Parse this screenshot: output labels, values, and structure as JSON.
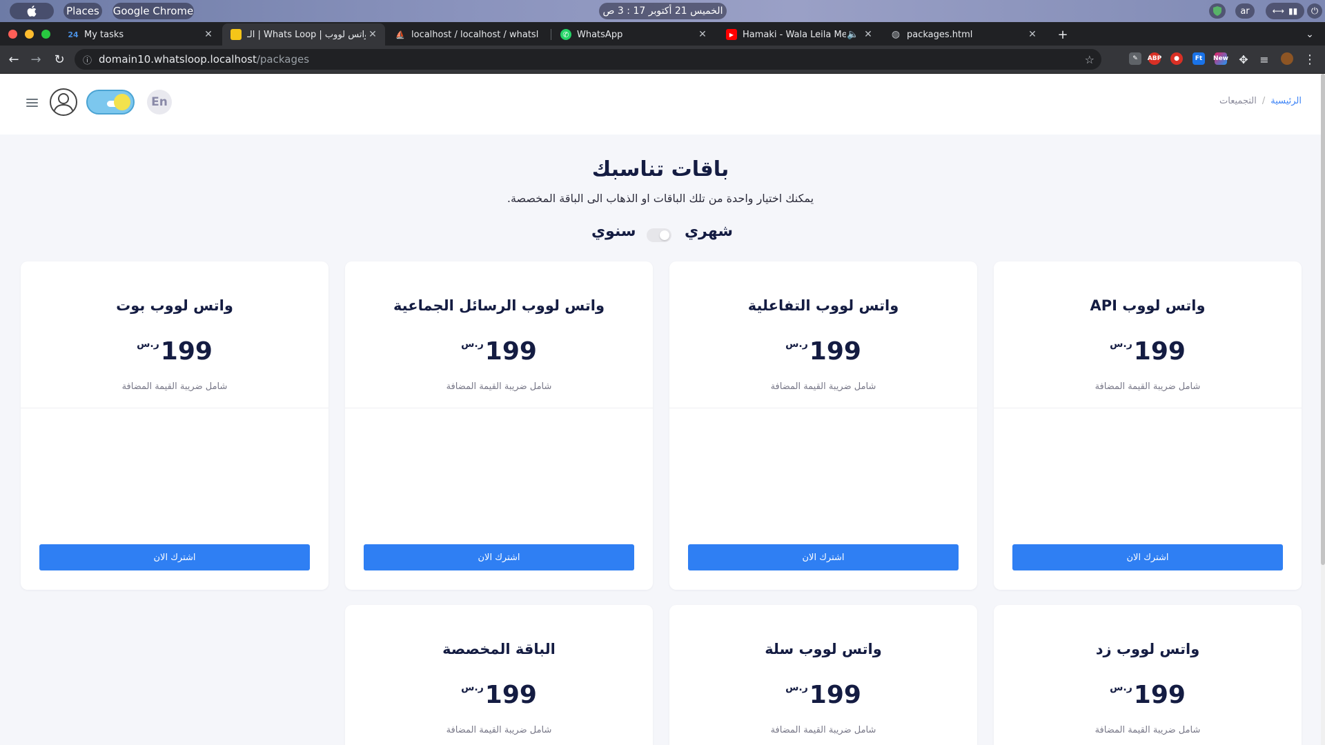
{
  "os_bar": {
    "apple": "",
    "places": "Places",
    "app": "Google Chrome",
    "datetime": "الخميس 21 أكتوبر 17 : 3 ص",
    "lang": "ar"
  },
  "tabs": [
    {
      "title": "My tasks",
      "favicon": "24"
    },
    {
      "title": "الـ | Whats Loop | واتس لووب",
      "favicon": "chat-icon"
    },
    {
      "title": "localhost / localhost / whatsl",
      "favicon": "pma-icon"
    },
    {
      "title": "WhatsApp",
      "favicon": "whatsapp-icon"
    },
    {
      "title": "Hamaki - Wala Leila Men L",
      "favicon": "youtube-icon"
    },
    {
      "title": "packages.html",
      "favicon": "globe-icon"
    }
  ],
  "address": {
    "host": "domain10.whatsloop.localhost",
    "path": "/packages"
  },
  "extensions": [
    "ABP",
    "Ft",
    "New"
  ],
  "header": {
    "lang_button": "En",
    "breadcrumb_home": "الرئيسية",
    "breadcrumb_sep": "/",
    "breadcrumb_current": "التجميعات"
  },
  "main": {
    "title": "باقات تناسبك",
    "subtitle": "يمكنك اختيار واحدة من تلك الباقات او الذهاب الى الباقة المخصصة.",
    "monthly": "شهري",
    "annual": "سنوي"
  },
  "packages": [
    {
      "name": "واتس لووب API",
      "price": "199",
      "currency": "ر.س",
      "vat": "شامل ضريبة القيمة المضافة",
      "cta": "اشترك الان"
    },
    {
      "name": "واتس لووب التفاعلية",
      "price": "199",
      "currency": "ر.س",
      "vat": "شامل ضريبة القيمة المضافة",
      "cta": "اشترك الان"
    },
    {
      "name": "واتس لووب الرسائل الجماعية",
      "price": "199",
      "currency": "ر.س",
      "vat": "شامل ضريبة القيمة المضافة",
      "cta": "اشترك الان"
    },
    {
      "name": "واتس لووب بوت",
      "price": "199",
      "currency": "ر.س",
      "vat": "شامل ضريبة القيمة المضافة",
      "cta": "اشترك الان"
    },
    {
      "name": "واتس لووب زد",
      "price": "199",
      "currency": "ر.س",
      "vat": "شامل ضريبة القيمة المضافة",
      "cta": ""
    },
    {
      "name": "واتس لووب سلة",
      "price": "199",
      "currency": "ر.س",
      "vat": "شامل ضريبة القيمة المضافة",
      "cta": ""
    },
    {
      "name": "الباقة المخصصة",
      "price": "199",
      "currency": "ر.س",
      "vat": "شامل ضريبة القيمة المضافة",
      "cta": ""
    }
  ],
  "colors": {
    "accent": "#2f7ff3",
    "heading": "#141c42",
    "page_bg": "#f5f6fa"
  }
}
